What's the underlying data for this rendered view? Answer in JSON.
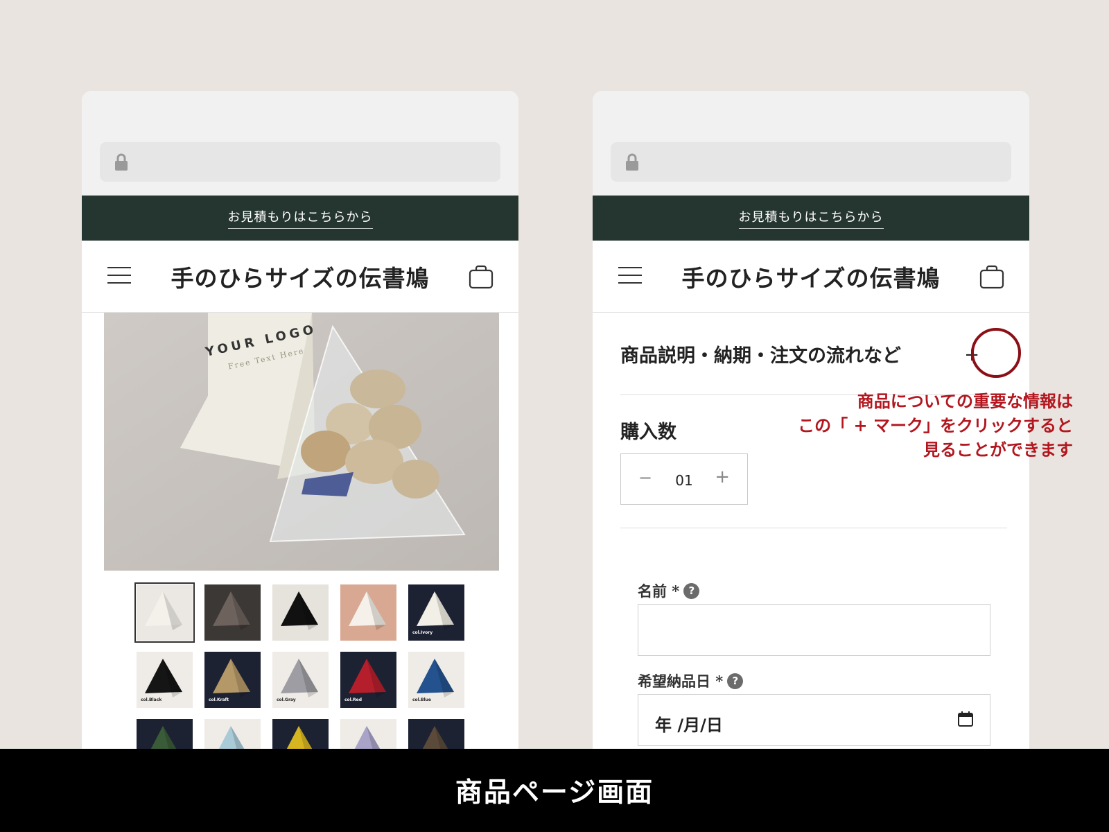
{
  "left_phone": {
    "announcement": "お見積もりはこちらから",
    "site_title": "手のひらサイズの伝書鳩",
    "product_image": {
      "logo_text": "YOUR LOGO",
      "sub_text": "Free Text Here"
    },
    "thumbnails": [
      {
        "label": "",
        "bg": "#ebe7e2",
        "fg": "#f4f1ea",
        "selected": true
      },
      {
        "label": "",
        "bg": "#3b3836",
        "fg": "#6d625c",
        "selected": false
      },
      {
        "label": "",
        "bg": "#e6e2dc",
        "fg": "#111111",
        "selected": false
      },
      {
        "label": "",
        "bg": "#d9a892",
        "fg": "#f5f1ea",
        "selected": false
      },
      {
        "label": "col.Ivory",
        "bg": "#1d2233",
        "fg": "#f2efe6",
        "selected": false
      },
      {
        "label": "col.Black",
        "bg": "#efebe6",
        "fg": "#151515",
        "selected": false
      },
      {
        "label": "col.Kraft",
        "bg": "#1d2233",
        "fg": "#b59868",
        "selected": false
      },
      {
        "label": "col.Gray",
        "bg": "#efebe6",
        "fg": "#9d9da3",
        "selected": false
      },
      {
        "label": "col.Red",
        "bg": "#1d2233",
        "fg": "#b51f2c",
        "selected": false
      },
      {
        "label": "col.Blue",
        "bg": "#efebe6",
        "fg": "#24528e",
        "selected": false
      },
      {
        "label": "",
        "bg": "#1d2233",
        "fg": "#3a5b38",
        "selected": false
      },
      {
        "label": "",
        "bg": "#efebe6",
        "fg": "#a9cbd8",
        "selected": false
      },
      {
        "label": "",
        "bg": "#1d2233",
        "fg": "#d7b520",
        "selected": false
      },
      {
        "label": "",
        "bg": "#efebe6",
        "fg": "#a9a3c8",
        "selected": false
      },
      {
        "label": "",
        "bg": "#1d2233",
        "fg": "#5b4a3a",
        "selected": false
      }
    ]
  },
  "right_phone": {
    "announcement": "お見積もりはこちらから",
    "site_title": "手のひらサイズの伝書鳩",
    "accordion_title": "商品説明・納期・注文の流れなど",
    "accordion_plus": "+",
    "quantity_label": "購入数",
    "quantity": {
      "minus": "−",
      "value": "01",
      "plus": "+"
    },
    "name_label": "名前 *",
    "help_mark": "?",
    "date_label": "希望納品日 *",
    "date_value": "年 /月/日"
  },
  "annotation": {
    "line1": "商品についての重要な情報は",
    "line2": "この「 + マーク」をクリックすると",
    "line3": "見ることができます"
  },
  "caption": "商品ページ画面",
  "colors": {
    "background": "#e9e4df",
    "announcement_bar": "#253630",
    "accent_red": "#b3161e",
    "ring": "#8b0f16"
  }
}
